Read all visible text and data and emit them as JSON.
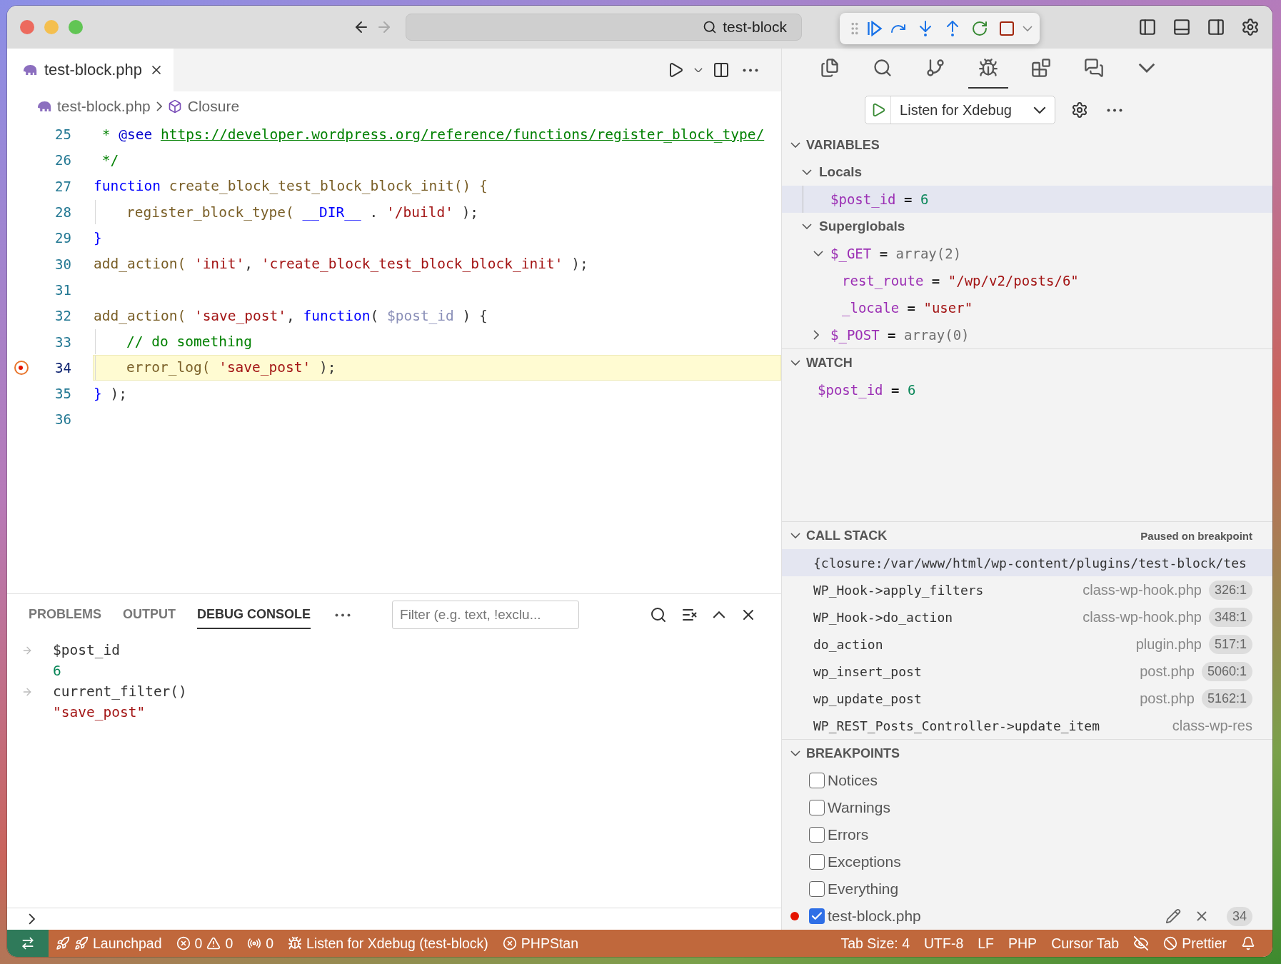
{
  "window": {
    "search": "test-block"
  },
  "editor_tabs": [
    {
      "label": "test-block.php",
      "selected": true
    }
  ],
  "breadcrumbs": [
    "test-block.php",
    "Closure"
  ],
  "code_lines": [
    {
      "number": "25",
      "indented": false,
      "current": false,
      "breakpoint": false,
      "tokens": [
        {
          "kind": "comment",
          "text": " * "
        },
        {
          "kind": "tag",
          "text": "@see "
        },
        {
          "kind": "link",
          "text": "https://developer.wordpress.org/reference/functions/register_block_type/"
        }
      ]
    },
    {
      "number": "26",
      "indented": false,
      "current": false,
      "breakpoint": false,
      "tokens": [
        {
          "kind": "comment",
          "text": " */"
        }
      ]
    },
    {
      "number": "27",
      "indented": false,
      "current": false,
      "breakpoint": false,
      "tokens": [
        {
          "kind": "keyword",
          "text": "function"
        },
        {
          "kind": "function",
          "text": " create_block_test_block_block_init() {"
        }
      ]
    },
    {
      "number": "28",
      "indented": true,
      "current": false,
      "breakpoint": false,
      "tokens": [
        {
          "kind": "function",
          "text": "register_block_type( "
        },
        {
          "kind": "constant",
          "text": "__DIR__"
        },
        {
          "kind": "plain",
          "text": " . "
        },
        {
          "kind": "string",
          "text": "'/build'"
        },
        {
          "kind": "plain",
          "text": " );"
        }
      ]
    },
    {
      "number": "29",
      "indented": false,
      "current": false,
      "breakpoint": false,
      "tokens": [
        {
          "kind": "keyword",
          "text": "}"
        }
      ]
    },
    {
      "number": "30",
      "indented": false,
      "current": false,
      "breakpoint": false,
      "tokens": [
        {
          "kind": "function",
          "text": "add_action( "
        },
        {
          "kind": "string",
          "text": "'init'"
        },
        {
          "kind": "plain",
          "text": ", "
        },
        {
          "kind": "string",
          "text": "'create_block_test_block_block_init'"
        },
        {
          "kind": "plain",
          "text": " );"
        }
      ]
    },
    {
      "number": "31",
      "indented": false,
      "current": false,
      "breakpoint": false
    },
    {
      "number": "32",
      "indented": false,
      "current": false,
      "breakpoint": false,
      "tokens": [
        {
          "kind": "function",
          "text": "add_action( "
        },
        {
          "kind": "string",
          "text": "'save_post'"
        },
        {
          "kind": "plain",
          "text": ", "
        },
        {
          "kind": "keyword",
          "text": "function"
        },
        {
          "kind": "plain",
          "text": "( "
        },
        {
          "kind": "param",
          "text": "$post_id"
        },
        {
          "kind": "plain",
          "text": " ) {"
        }
      ]
    },
    {
      "number": "33",
      "indented": true,
      "current": false,
      "breakpoint": false,
      "tokens": [
        {
          "kind": "comment",
          "text": "// do something"
        }
      ]
    },
    {
      "number": "34",
      "indented": true,
      "current": true,
      "breakpoint": true,
      "tokens": [
        {
          "kind": "function",
          "text": "error_log( "
        },
        {
          "kind": "string",
          "text": "'save_post'"
        },
        {
          "kind": "plain",
          "text": " );"
        }
      ]
    },
    {
      "number": "35",
      "indented": false,
      "current": false,
      "breakpoint": false,
      "tokens": [
        {
          "kind": "keyword",
          "text": "}"
        },
        {
          "kind": "plain",
          "text": " );"
        }
      ]
    },
    {
      "number": "36",
      "indented": false,
      "current": false,
      "breakpoint": false
    }
  ],
  "panel": {
    "tabs": [
      {
        "label": "PROBLEMS",
        "selected": false
      },
      {
        "label": "OUTPUT",
        "selected": false
      },
      {
        "label": "DEBUG CONSOLE",
        "selected": true
      }
    ],
    "filter_placeholder": "Filter (e.g. text, !exclu...",
    "console": [
      {
        "kind": "input",
        "text": "$post_id"
      },
      {
        "kind": "number",
        "text": "6"
      },
      {
        "kind": "input",
        "text": "current_filter()"
      },
      {
        "kind": "string",
        "text": "\"save_post\""
      }
    ]
  },
  "activity_bar": [
    {
      "kind": "explorer",
      "selected": false
    },
    {
      "kind": "search",
      "selected": false
    },
    {
      "kind": "scm",
      "selected": false
    },
    {
      "kind": "debug",
      "selected": true
    },
    {
      "kind": "extensions",
      "selected": false
    },
    {
      "kind": "chat",
      "selected": false
    }
  ],
  "run_config": {
    "name": "Listen for Xdebug"
  },
  "variables": {
    "title": "VARIABLES",
    "expanded": true,
    "tree": [
      {
        "kind": "scope",
        "name": "Locals",
        "expanded": true,
        "selected": false,
        "children": [
          {
            "kind": "number",
            "name": "$post_id",
            "equals": "=",
            "value": "6",
            "selected": true
          }
        ]
      },
      {
        "kind": "scope",
        "name": "Superglobals",
        "expanded": true,
        "selected": false,
        "children": [
          {
            "kind": "array",
            "name": "$_GET",
            "equals": "=",
            "value": "array(2)",
            "expanded": true,
            "selected": false,
            "children": [
              {
                "kind": "string",
                "name": "rest_route",
                "equals": "=",
                "value": "\"/wp/v2/posts/6\"",
                "selected": false
              },
              {
                "kind": "string",
                "name": "_locale",
                "equals": "=",
                "value": "\"user\"",
                "selected": false
              }
            ]
          },
          {
            "kind": "array",
            "name": "$_POST",
            "equals": "=",
            "value": "array(0)",
            "expanded": false,
            "selected": false
          }
        ]
      }
    ]
  },
  "watch": {
    "title": "WATCH",
    "expanded": true,
    "items": [
      {
        "kind": "number",
        "name": "$post_id",
        "equals": "=",
        "value": "6"
      }
    ]
  },
  "call_stack": {
    "title": "CALL STACK",
    "expanded": true,
    "status": "Paused on breakpoint",
    "frames": [
      {
        "name": "{closure:/var/www/html/wp-content/plugins/test-block/tes",
        "selected": true
      },
      {
        "name": "WP_Hook->apply_filters",
        "file": "class-wp-hook.php",
        "position": "326:1",
        "selected": false
      },
      {
        "name": "WP_Hook->do_action",
        "file": "class-wp-hook.php",
        "position": "348:1",
        "selected": false
      },
      {
        "name": "do_action",
        "file": "plugin.php",
        "position": "517:1",
        "selected": false
      },
      {
        "name": "wp_insert_post",
        "file": "post.php",
        "position": "5060:1",
        "selected": false
      },
      {
        "name": "wp_update_post",
        "file": "post.php",
        "position": "5162:1",
        "selected": false
      },
      {
        "name": "WP_REST_Posts_Controller->update_item",
        "file": "class-wp-res",
        "selected": false
      }
    ]
  },
  "breakpoints": {
    "title": "BREAKPOINTS",
    "expanded": true,
    "items": [
      {
        "kind": "exception",
        "label": "Notices",
        "checked": false
      },
      {
        "kind": "exception",
        "label": "Warnings",
        "checked": false
      },
      {
        "kind": "exception",
        "label": "Errors",
        "checked": false
      },
      {
        "kind": "exception",
        "label": "Exceptions",
        "checked": false
      },
      {
        "kind": "exception",
        "label": "Everything",
        "checked": false
      },
      {
        "kind": "file",
        "label": "test-block.php",
        "checked": true,
        "line": "34"
      }
    ]
  },
  "status_bar": {
    "left": [
      {
        "kind": "launchpad",
        "text": "Launchpad"
      },
      {
        "kind": "problems",
        "errors": "0",
        "warnings": "0"
      },
      {
        "kind": "ports",
        "text": "0"
      },
      {
        "kind": "debug",
        "text": "Listen for Xdebug (test-block)"
      },
      {
        "kind": "phpstan",
        "text": "PHPStan"
      }
    ],
    "right": [
      {
        "kind": "text",
        "text": "Tab Size: 4"
      },
      {
        "kind": "text",
        "text": "UTF-8"
      },
      {
        "kind": "text",
        "text": "LF"
      },
      {
        "kind": "text",
        "text": "PHP"
      },
      {
        "kind": "text",
        "text": "Cursor Tab"
      },
      {
        "kind": "copilot"
      },
      {
        "kind": "prettier",
        "text": "Prettier"
      },
      {
        "kind": "bell"
      }
    ]
  }
}
